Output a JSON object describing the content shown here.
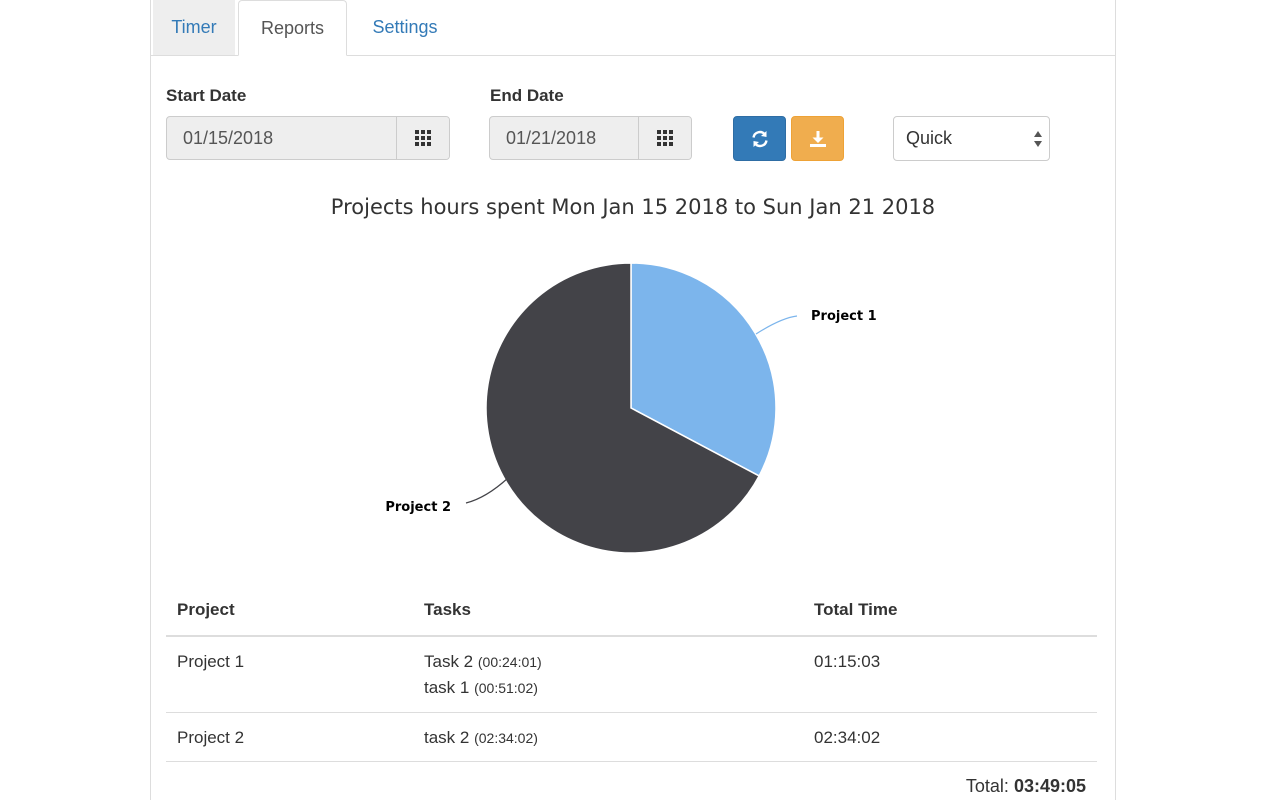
{
  "tabs": [
    {
      "label": "Timer",
      "active": false
    },
    {
      "label": "Reports",
      "active": true
    },
    {
      "label": "Settings",
      "active": false
    }
  ],
  "filters": {
    "start_label": "Start Date",
    "start_value": "01/15/2018",
    "end_label": "End Date",
    "end_value": "01/21/2018",
    "range_select": "Quick",
    "refresh_icon": "refresh-icon",
    "download_icon": "download-icon",
    "calendar_icon": "calendar-grid-icon"
  },
  "chart_data": {
    "type": "pie",
    "title": "Projects hours spent Mon Jan 15 2018 to Sun Jan 21 2018",
    "slices": [
      {
        "label": "Project 1",
        "value": 75.05,
        "color": "#7cb5ec"
      },
      {
        "label": "Project 2",
        "value": 154.03,
        "color": "#434348"
      }
    ]
  },
  "table": {
    "headers": [
      "Project",
      "Tasks",
      "Total Time"
    ],
    "rows": [
      {
        "project": "Project 1",
        "tasks": [
          {
            "name": "Task 2",
            "duration": "(00:24:01)"
          },
          {
            "name": "task 1",
            "duration": "(00:51:02)"
          }
        ],
        "total": "01:15:03"
      },
      {
        "project": "Project 2",
        "tasks": [
          {
            "name": "task 2",
            "duration": "(02:34:02)"
          }
        ],
        "total": "02:34:02"
      }
    ],
    "total_label": "Total:",
    "total_value": "03:49:05"
  }
}
